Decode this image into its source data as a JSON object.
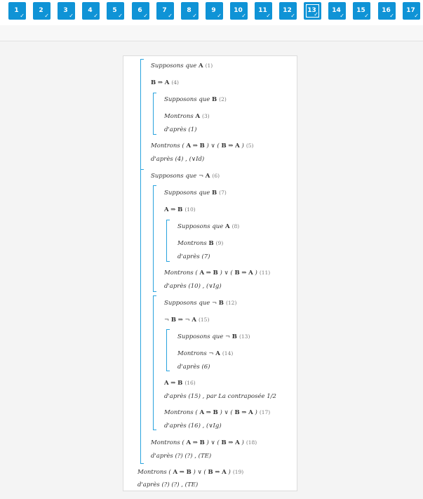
{
  "nav": {
    "steps": [
      "1",
      "2",
      "3",
      "4",
      "5",
      "6",
      "7",
      "8",
      "9",
      "10",
      "11",
      "12",
      "13",
      "14",
      "15",
      "16",
      "17"
    ],
    "active_step": "13",
    "check_glyph": "✓"
  },
  "colors": {
    "accent": "#0f93d6",
    "bracket": "#29a3de"
  },
  "proof": {
    "l1": {
      "text": "Supposons que A",
      "ref": "(1)"
    },
    "l2": {
      "text": "B ⇒ A",
      "ref": "(4)"
    },
    "l3": {
      "text": "Supposons que B",
      "ref": "(2)"
    },
    "l4": {
      "text": "Montrons A",
      "ref": "(3)"
    },
    "l5": {
      "text": "d'après (1)"
    },
    "l6": {
      "text": "Montrons ( A ⇒ B ) ∨ ( B ⇒ A )",
      "ref": "(5)"
    },
    "l7": {
      "text": "d'après (4) , (∨Id)"
    },
    "l8": {
      "text": "Supposons que ¬ A",
      "ref": "(6)"
    },
    "l9": {
      "text": "Supposons que B",
      "ref": "(7)"
    },
    "l10": {
      "text": "A ⇒ B",
      "ref": "(10)"
    },
    "l11": {
      "text": "Supposons que A",
      "ref": "(8)"
    },
    "l12": {
      "text": "Montrons B",
      "ref": "(9)"
    },
    "l13": {
      "text": "d'après (7)"
    },
    "l14": {
      "text": "Montrons ( A ⇒ B ) ∨ ( B ⇒ A )",
      "ref": "(11)"
    },
    "l15": {
      "text": "d'après (10) , (∨Ig)"
    },
    "l16": {
      "text": "Supposons que ¬ B",
      "ref": "(12)"
    },
    "l17": {
      "text": "¬ B ⇒ ¬ A",
      "ref": "(15)"
    },
    "l18": {
      "text": "Supposons que ¬ B",
      "ref": "(13)"
    },
    "l19": {
      "text": "Montrons ¬ A",
      "ref": "(14)"
    },
    "l20": {
      "text": "d'après (6)"
    },
    "l21": {
      "text": "A ⇒ B",
      "ref": "(16)"
    },
    "l22": {
      "text": "d'après (15) , par La contraposée 1/2"
    },
    "l23": {
      "text": "Montrons ( A ⇒ B ) ∨ ( B ⇒ A )",
      "ref": "(17)"
    },
    "l24": {
      "text": "d'après (16) , (∨Ig)"
    },
    "l25": {
      "text": "Montrons ( A ⇒ B ) ∨ ( B ⇒ A )",
      "ref": "(18)"
    },
    "l26": {
      "text": "d'après (?) (?) , (TE)"
    },
    "l27": {
      "text": "Montrons ( A ⇒ B ) ∨ ( B ⇒ A )",
      "ref": "(19)"
    },
    "l28": {
      "text": "d'après (?) (?) , (TE)"
    }
  }
}
